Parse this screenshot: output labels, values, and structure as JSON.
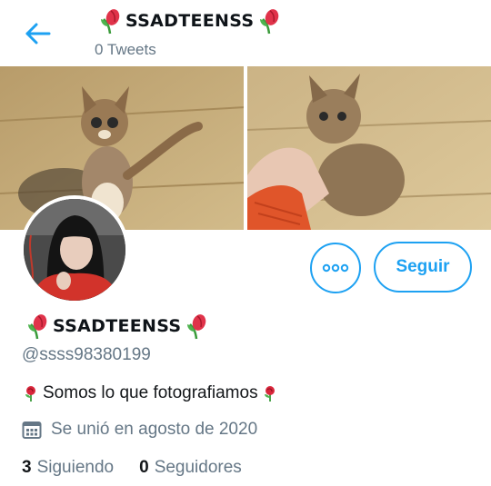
{
  "header": {
    "back_icon": "arrow-left-icon",
    "title": "SSADTEENSS",
    "tweets_count_label": "0 Tweets",
    "title_emoji_icon": "wilted-tulip-icon"
  },
  "banner": {
    "left_image": "kitten-sitting-photo",
    "right_image": "kitten-held-in-hand-photo"
  },
  "profile": {
    "avatar_image": "profile-photo-girl",
    "display_name": "SSADTEENSS",
    "handle": "@ssss98380199",
    "bio": "Somos lo que fotografiamos",
    "bio_emoji_icon": "rose-icon",
    "joined": "Se unió en agosto de 2020",
    "joined_icon": "calendar-icon",
    "following_count": "3",
    "following_label": "Siguiendo",
    "followers_count": "0",
    "followers_label": "Seguidores"
  },
  "actions": {
    "more_icon": "more-options-icon",
    "follow_label": "Seguir"
  },
  "colors": {
    "accent": "#1da1f2",
    "secondary_text": "#657786",
    "primary_text": "#0f1419",
    "background": "#ffffff"
  }
}
